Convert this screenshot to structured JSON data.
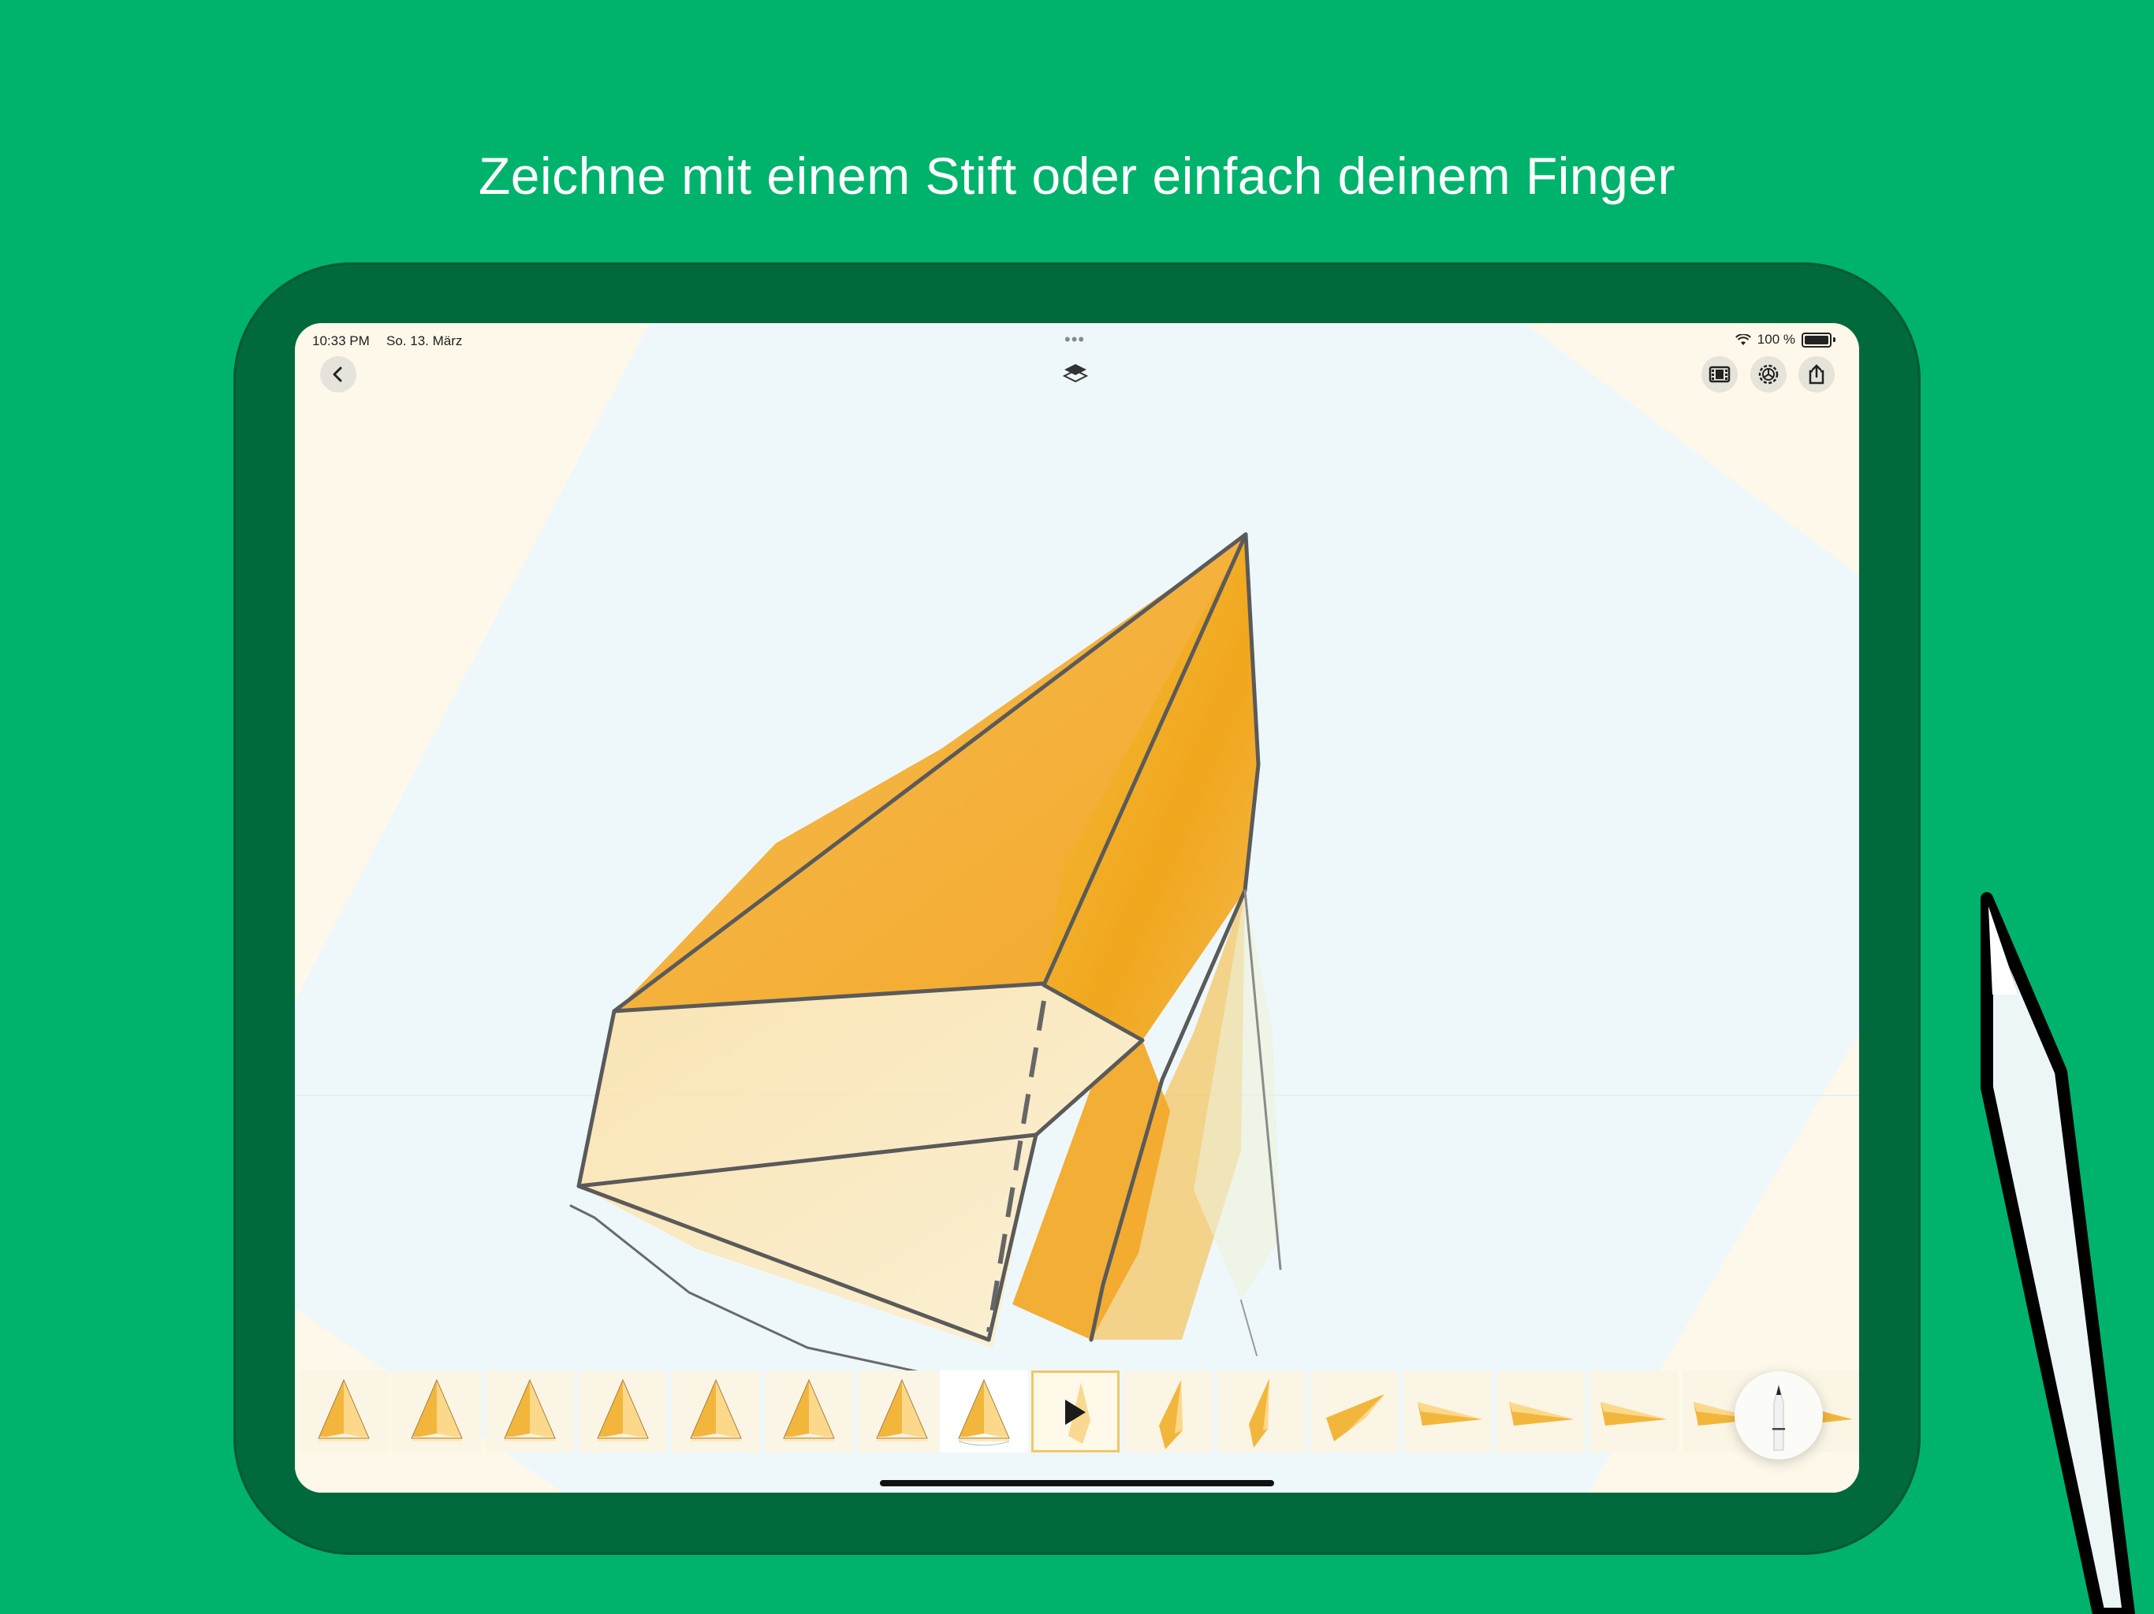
{
  "headline": "Zeichne mit einem Stift oder einfach deinem Finger",
  "status_bar": {
    "time": "10:33 PM",
    "date": "So. 13. März",
    "battery": "100 %"
  },
  "toolbar": {
    "back_icon": "chevron-left-icon",
    "layers_icon": "layers-icon",
    "film_icon": "film-icon",
    "settings_icon": "gear-icon",
    "share_icon": "share-icon"
  },
  "filmstrip": {
    "frame_count": 17,
    "selected_frame": 9,
    "play_icon": "play-icon"
  },
  "pen_tool_icon": "pencil-icon",
  "colors": {
    "background": "#00b36c",
    "device_bezel": "#006a3d",
    "paper": "#fdf8ea",
    "canvas_tint": "#eef8fb",
    "paint_orange": "#f3a923",
    "pencil_stroke": "#555555"
  }
}
